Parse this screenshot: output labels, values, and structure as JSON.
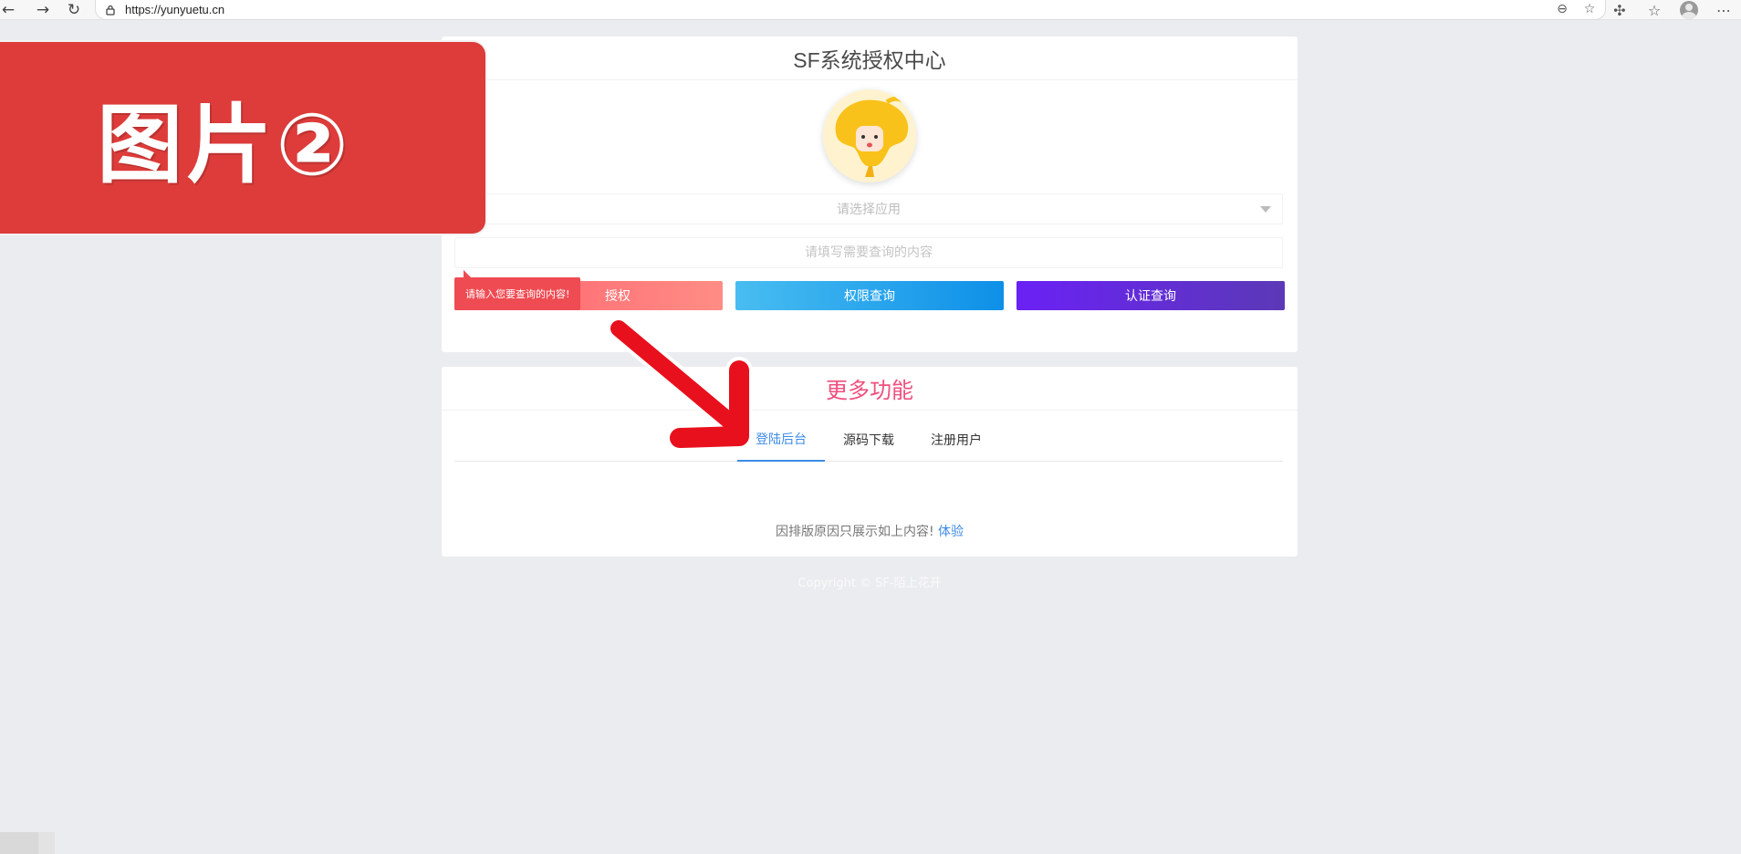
{
  "browser": {
    "url": "https://yunyuetu.cn",
    "icons": [
      "back-icon",
      "forward-icon",
      "reload-icon",
      "lock-icon",
      "reader-icon",
      "favorite-icon",
      "extensions-icon",
      "favorites-bar-icon",
      "profile-icon",
      "more-icon"
    ]
  },
  "main_card": {
    "title": "SF系统授权中心",
    "select_placeholder": "请选择应用",
    "input_placeholder": "请填写需要查询的内容",
    "buttons": [
      "授权",
      "权限查询",
      "认证查询"
    ],
    "tooltip": "请输入您要查询的内容!"
  },
  "more_card": {
    "title": "更多功能",
    "tabs": [
      "登陆后台",
      "源码下载",
      "注册用户"
    ],
    "active_tab": "登陆后台",
    "notice_text": "因排版原因只展示如上内容!",
    "notice_link": "体验"
  },
  "footer": {
    "copyright": "Copyright © SF-陌上花开"
  },
  "overlay": {
    "label": "图片②"
  },
  "colors": {
    "page_bg": "#ebecf0",
    "banner_red": "#dd3c3a",
    "more_title": "#ef4f7e",
    "tab_active": "#3d8be6"
  }
}
